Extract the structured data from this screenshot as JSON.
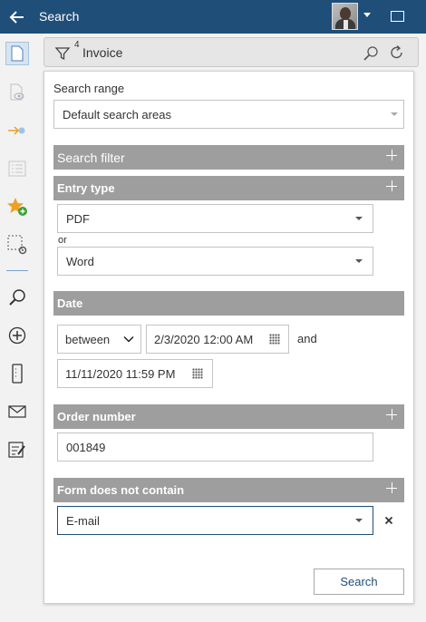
{
  "titlebar": {
    "title": "Search",
    "bg": "#1f4e79"
  },
  "sidebar": {
    "items": [
      {
        "name": "new-document-icon",
        "active": true
      },
      {
        "name": "view-document-icon"
      },
      {
        "name": "pin-arrow-icon"
      },
      {
        "name": "list-icon"
      },
      {
        "name": "add-favorite-icon"
      },
      {
        "name": "selection-settings-icon"
      },
      {
        "name": "search-icon"
      },
      {
        "name": "add-circle-icon"
      },
      {
        "name": "mobile-device-icon"
      },
      {
        "name": "mail-icon"
      },
      {
        "name": "edit-form-icon"
      }
    ]
  },
  "searchbar": {
    "filter_count": "4",
    "term": "Invoice"
  },
  "search_range": {
    "label": "Search range",
    "value": "Default search areas"
  },
  "sections": {
    "search_filter": "Search filter",
    "entry_type": "Entry type",
    "date": "Date",
    "order_number": "Order number",
    "form_not_contain": "Form does not contain"
  },
  "entry_type": {
    "first": "PDF",
    "or_label": "or",
    "second": "Word"
  },
  "date": {
    "operator": "between",
    "from": "2/3/2020 12:00 AM",
    "and_label": "and",
    "to": "11/11/2020 11:59 PM"
  },
  "order_number": {
    "value": "001849"
  },
  "form_not_contain": {
    "value": "E-mail"
  },
  "actions": {
    "search_label": "Search"
  },
  "colors": {
    "accent": "#1f4e79",
    "section_header": "#9e9e9e",
    "star": "#f0a020",
    "add_green": "#3aa335"
  }
}
